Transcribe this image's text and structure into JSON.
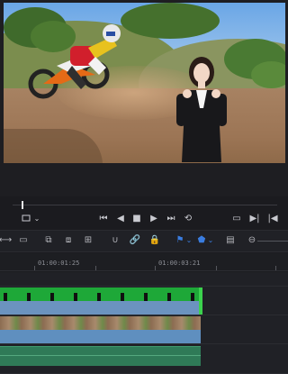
{
  "transport": {
    "icons": [
      "crop-icon",
      "chevron-down-icon",
      "skip-start-icon",
      "step-back-icon",
      "stop-icon",
      "play-icon",
      "skip-end-icon",
      "loop-icon",
      "mark-icon",
      "next-clip-icon",
      "prev-clip-icon"
    ]
  },
  "toolbar": {
    "icons": [
      "trim-icon",
      "blade-icon",
      "insert-icon",
      "overwrite-icon",
      "replace-icon",
      "snap-icon",
      "link-icon",
      "lock-icon",
      "flag-icon",
      "chevron-down-icon",
      "marker-icon",
      "chevron-down-icon",
      "zoom-icon",
      "zoom-out-icon"
    ]
  },
  "timeline": {
    "timecodes": [
      "01:00:01:25",
      "01:00:03:21"
    ]
  },
  "colors": {
    "green_clip": "#1ea838",
    "blue_clip": "#5f8fbf",
    "audio_clip": "#2f7a57",
    "playhead": "#d22a2a"
  }
}
